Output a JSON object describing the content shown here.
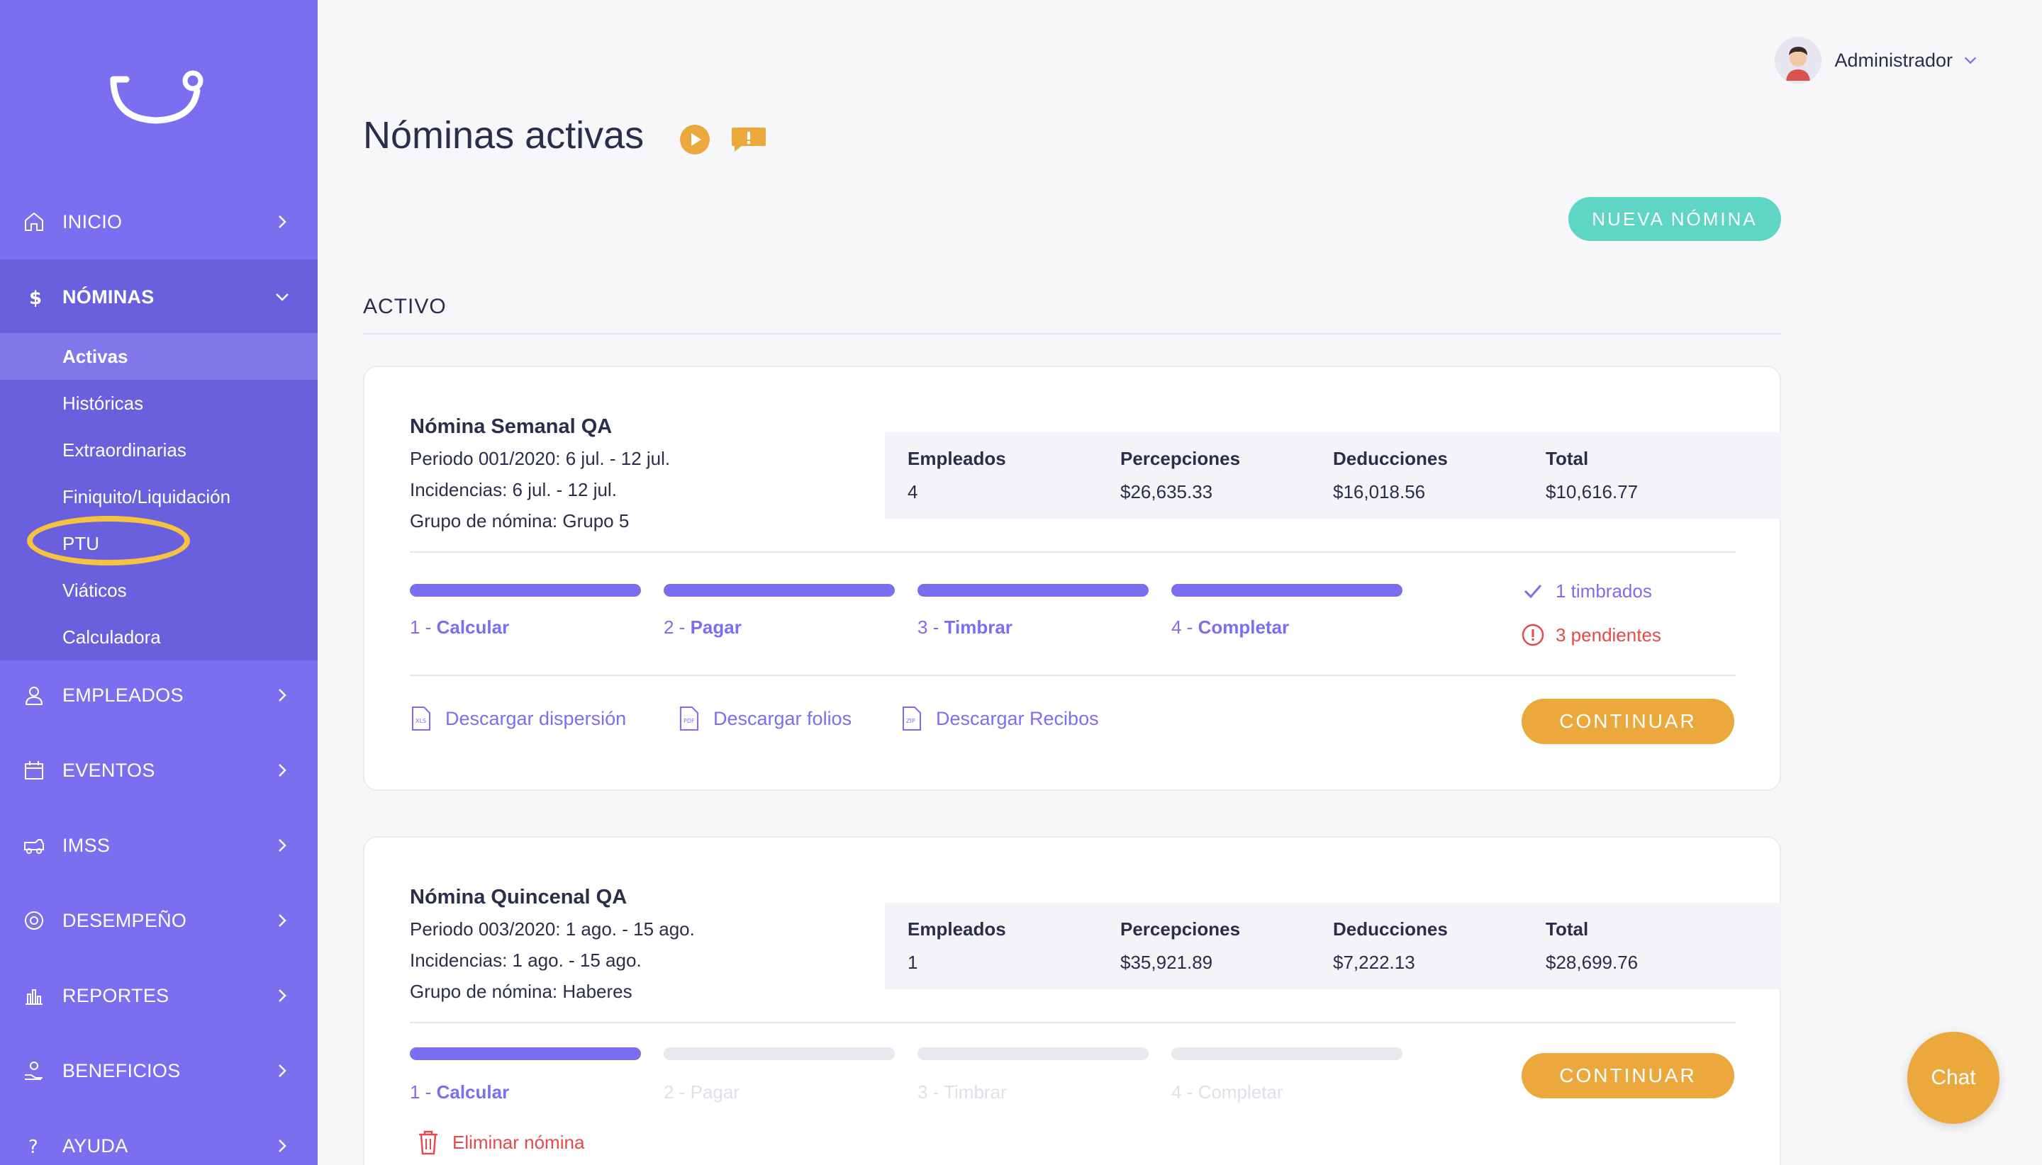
{
  "sidebar": {
    "items": [
      {
        "label": "INICIO"
      },
      {
        "label": "NÓMINAS"
      },
      {
        "label": "EMPLEADOS"
      },
      {
        "label": "EVENTOS"
      },
      {
        "label": "IMSS"
      },
      {
        "label": "DESEMPEÑO"
      },
      {
        "label": "REPORTES"
      },
      {
        "label": "BENEFICIOS"
      },
      {
        "label": "AYUDA"
      }
    ],
    "submenu": [
      {
        "label": "Activas"
      },
      {
        "label": "Históricas"
      },
      {
        "label": "Extraordinarias"
      },
      {
        "label": "Finiquito/Liquidación"
      },
      {
        "label": "PTU"
      },
      {
        "label": "Viáticos"
      },
      {
        "label": "Calculadora"
      }
    ]
  },
  "header": {
    "user_name": "Administrador",
    "title": "Nóminas activas",
    "new_button": "NUEVA NÓMINA",
    "section": "ACTIVO"
  },
  "cards": [
    {
      "name": "Nómina Semanal QA",
      "period": "Periodo 001/2020: 6 jul. - 12 jul.",
      "incidents": "Incidencias: 6 jul. - 12 jul.",
      "group": "Grupo de nómina: Grupo 5",
      "stats": {
        "employees_label": "Empleados",
        "employees": "4",
        "perceptions_label": "Percepciones",
        "perceptions": "$26,635.33",
        "deductions_label": "Deducciones",
        "deductions": "$16,018.56",
        "total_label": "Total",
        "total": "$10,616.77"
      },
      "steps": [
        {
          "num": "1 - ",
          "label": "Calcular"
        },
        {
          "num": "2 - ",
          "label": "Pagar"
        },
        {
          "num": "3 - ",
          "label": "Timbrar"
        },
        {
          "num": "4 - ",
          "label": "Completar"
        }
      ],
      "stamped": "1 timbrados",
      "pending": "3 pendientes",
      "downloads": [
        "Descargar dispersión",
        "Descargar folios",
        "Descargar Recibos"
      ],
      "continue": "CONTINUAR"
    },
    {
      "name": "Nómina Quincenal QA",
      "period": "Periodo 003/2020: 1 ago. - 15 ago.",
      "incidents": "Incidencias: 1 ago. - 15 ago.",
      "group": "Grupo de nómina: Haberes",
      "stats": {
        "employees_label": "Empleados",
        "employees": "1",
        "perceptions_label": "Percepciones",
        "perceptions": "$35,921.89",
        "deductions_label": "Deducciones",
        "deductions": "$7,222.13",
        "total_label": "Total",
        "total": "$28,699.76"
      },
      "steps": [
        {
          "num": "1 - ",
          "label": "Calcular"
        },
        {
          "num": "2 - ",
          "label": "Pagar"
        },
        {
          "num": "3 - ",
          "label": "Timbrar"
        },
        {
          "num": "4 - ",
          "label": "Completar"
        }
      ],
      "delete": "Eliminar nómina",
      "continue": "CONTINUAR"
    }
  ],
  "chat": "Chat",
  "colors": {
    "sidebar": "#7b6ff0",
    "accent": "#7b6ff0",
    "new_button": "#5fd6c3",
    "continue_button": "#eba93d",
    "danger": "#e6494c",
    "highlight_ring": "#f5c242"
  }
}
